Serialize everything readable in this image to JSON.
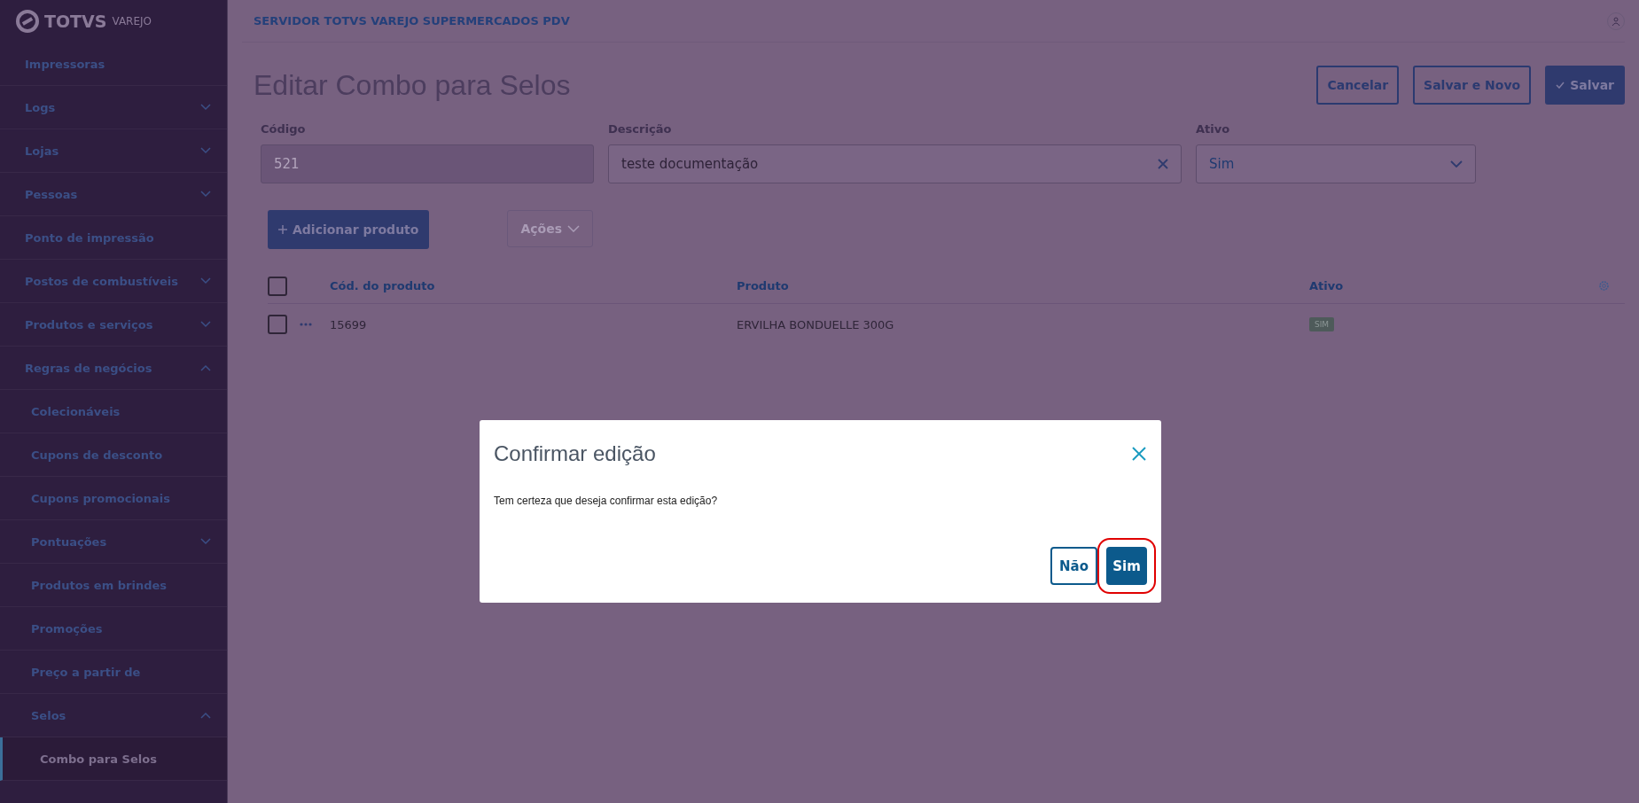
{
  "sidebar": {
    "logo": {
      "brand": "TOTVS",
      "product": "VAREJO"
    },
    "items": [
      {
        "label": "Impressoras",
        "selected": false
      },
      {
        "label": "Logs",
        "selected": false,
        "expanded": false
      },
      {
        "label": "Lojas",
        "selected": false,
        "expanded": false
      },
      {
        "label": "Pessoas",
        "selected": false,
        "expanded": false
      },
      {
        "label": "Ponto de impressão",
        "selected": false
      },
      {
        "label": "Postos de combustíveis",
        "selected": false,
        "expanded": false
      },
      {
        "label": "Produtos e serviços",
        "selected": false,
        "expanded": false
      },
      {
        "label": "Regras de negócios",
        "selected": false,
        "expanded": true,
        "children": [
          {
            "label": "Colecionáveis",
            "selected": false
          },
          {
            "label": "Cupons de desconto",
            "selected": false
          },
          {
            "label": "Cupons promocionais",
            "selected": false
          },
          {
            "label": "Pontuações",
            "selected": false,
            "expanded": false
          },
          {
            "label": "Produtos em brindes",
            "selected": false
          },
          {
            "label": "Promoções",
            "selected": false
          },
          {
            "label": "Preço a partir de",
            "selected": false
          },
          {
            "label": "Selos",
            "selected": false,
            "expanded": true,
            "children": [
              {
                "label": "Combo para Selos",
                "selected": true
              }
            ]
          }
        ]
      }
    ]
  },
  "header": {
    "server": "SERVIDOR TOTVS VAREJO SUPERMERCADOS PDV"
  },
  "page": {
    "title": "Editar Combo para Selos",
    "actions": [
      {
        "label": "Cancelar",
        "kind": "secondary"
      },
      {
        "label": "Salvar e Novo",
        "kind": "secondary"
      },
      {
        "label": "Salvar",
        "kind": "primary"
      }
    ],
    "fields": [
      {
        "label": "Código",
        "value": "521",
        "kind": "text",
        "disabled": true
      },
      {
        "label": "Descrição",
        "value": "teste documentação",
        "kind": "clearable",
        "disabled": false
      },
      {
        "label": "Ativo",
        "value": "Sim",
        "kind": "select",
        "disabled": false
      }
    ],
    "add_button": "Adicionar produto",
    "actions_menu": {
      "label": "Ações",
      "disabled": true
    },
    "table": {
      "all_checked": false,
      "columns": [
        "Cód. do produto",
        "Produto",
        "Ativo"
      ],
      "rows": [
        {
          "checked": false,
          "code": "15699",
          "product": "ERVILHA BONDUELLE 300G",
          "active": "SIM"
        }
      ]
    }
  },
  "dialog": {
    "title": "Confirmar edição",
    "message": "Tem certeza que deseja confirmar esta edição?",
    "buttons": [
      {
        "label": "Não",
        "kind": "secondary",
        "highlighted": false
      },
      {
        "label": "Sim",
        "kind": "primary",
        "highlighted": true
      }
    ]
  }
}
